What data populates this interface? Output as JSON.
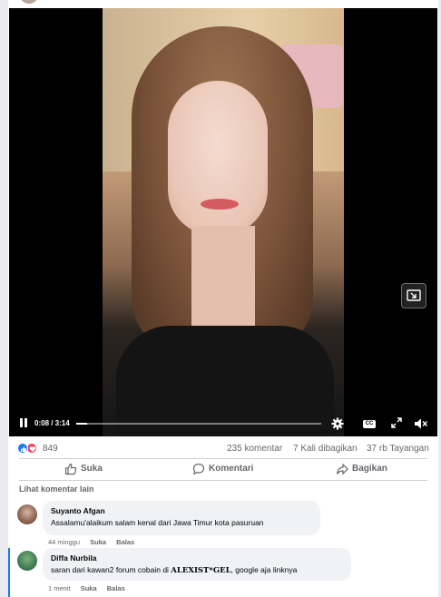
{
  "video": {
    "time_label": "0:08 / 3:14",
    "progress": 0.043,
    "cc_label": "CC"
  },
  "stats": {
    "reactions_count": "849",
    "comments": "235 komentar",
    "shares": "7 Kali dibagikan",
    "views": "37 rb Tayangan"
  },
  "actions": {
    "like": "Suka",
    "comment": "Komentari",
    "share": "Bagikan"
  },
  "comments_section": {
    "more_label": "Lihat komentar lain",
    "items": [
      {
        "author": "Suyanto Afgan",
        "text": "Assalamu'alaikum salam kenal dari Jawa Timur kota pasuruan",
        "time": "44 minggu",
        "like": "Suka",
        "reply": "Balas"
      },
      {
        "author": "Diffa Nurbila",
        "text_before": "saran dari kawan2 forum cobain di ",
        "text_highlight": "ALEXIST*GEL",
        "text_after": ", google aja linknya",
        "time": "1 menit",
        "like": "Suka",
        "reply": "Balas"
      }
    ]
  },
  "colors": {
    "accent": "#1877f2",
    "love": "#f33e58",
    "secondary_text": "#65676b",
    "bubble": "#f0f2f5"
  },
  "icons": [
    "pause-icon",
    "settings-gear-icon",
    "closed-captions-icon",
    "expand-icon",
    "mute-icon",
    "picture-in-picture-icon",
    "like-reaction-icon",
    "love-reaction-icon",
    "thumbs-up-icon",
    "comment-icon",
    "share-arrow-icon"
  ]
}
